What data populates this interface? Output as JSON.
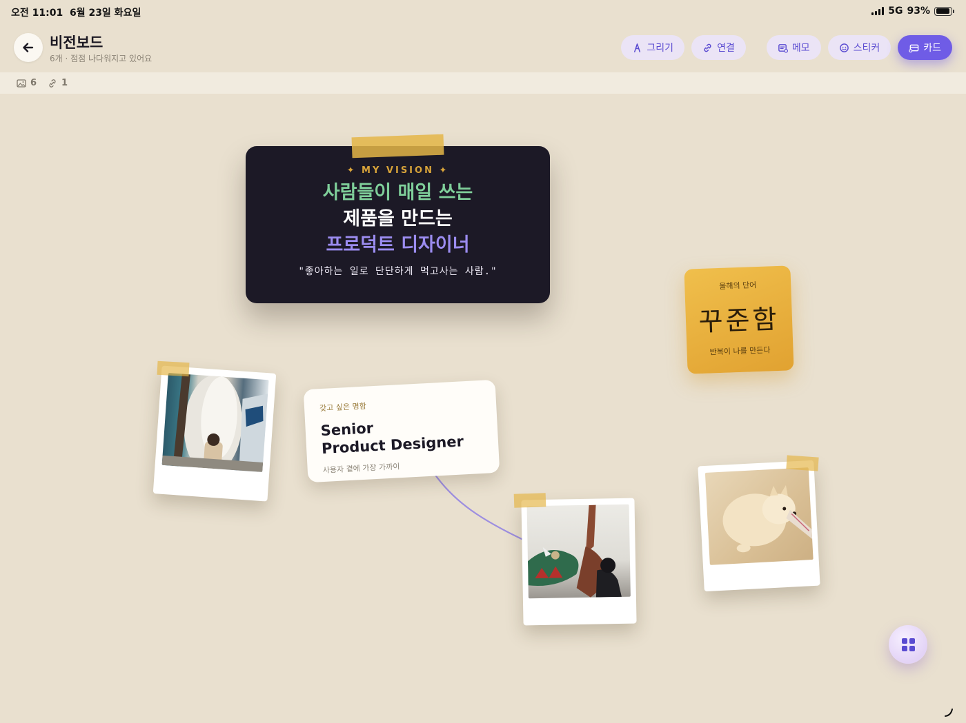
{
  "status_bar": {
    "time": "오전 11:01",
    "date": "6월 23일 화요일",
    "network": "5G",
    "battery": "93%",
    "battery_level": 0.93
  },
  "header": {
    "title": "비전보드",
    "subtitle": "6개 · 점점 나다워지고 있어요",
    "tools": {
      "draw": "그리기",
      "link": "연결",
      "memo": "메모",
      "sticker": "스티커",
      "card": "카드"
    }
  },
  "counts": {
    "images": "6",
    "links": "1"
  },
  "vision_card": {
    "eyebrow": "✦ MY VISION ✦",
    "line1": "사람들이 매일 쓰는",
    "line2": "제품을 만드는",
    "line3": "프로덕트 디자이너",
    "quote": "\"좋아하는 일로 단단하게 먹고사는 사람.\"",
    "colors": {
      "background": "#1c1926",
      "line1": "#7fcf9a",
      "line3": "#9b8cf0",
      "eyebrow": "#d9a43a"
    }
  },
  "word_card": {
    "label": "올해의 단어",
    "word": "꾸준함",
    "sub": "반복이 나를 만든다"
  },
  "name_card": {
    "label": "갖고 싶은 명함",
    "title_line1": "Senior",
    "title_line2": "Product Designer",
    "sub": "사용자 곁에 가장 가까이"
  },
  "photos": [
    {
      "subject": "child-with-penguin-statue"
    },
    {
      "subject": "child-with-dinosaur-models"
    },
    {
      "subject": "pomeranian-puppy"
    }
  ],
  "colors": {
    "canvas": "#e9e0cf",
    "accent": "#6f5ce6",
    "connector": "#9d8ee0",
    "tape": "#e4b648"
  }
}
